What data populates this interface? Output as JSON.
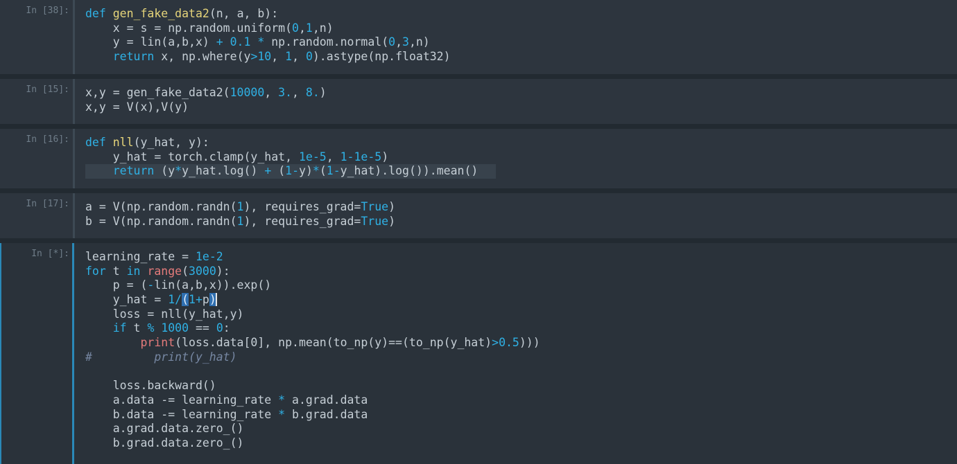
{
  "cells": [
    {
      "prompt": "In [38]:",
      "lines": [
        [
          [
            "kw",
            "def"
          ],
          [
            "t",
            " "
          ],
          [
            "fn",
            "gen_fake_data2"
          ],
          [
            "t",
            "(n, a, b):"
          ]
        ],
        [
          [
            "t",
            "    x = s = np.random.uniform("
          ],
          [
            "num",
            "0"
          ],
          [
            "t",
            ","
          ],
          [
            "num",
            "1"
          ],
          [
            "t",
            ",n)"
          ]
        ],
        [
          [
            "t",
            "    y = lin(a,b,x) "
          ],
          [
            "op",
            "+"
          ],
          [
            "t",
            " "
          ],
          [
            "num",
            "0.1"
          ],
          [
            "t",
            " "
          ],
          [
            "op",
            "*"
          ],
          [
            "t",
            " np.random.normal("
          ],
          [
            "num",
            "0"
          ],
          [
            "t",
            ","
          ],
          [
            "num",
            "3"
          ],
          [
            "t",
            ",n)"
          ]
        ],
        [
          [
            "t",
            "    "
          ],
          [
            "kw",
            "return"
          ],
          [
            "t",
            " x, np.where(y"
          ],
          [
            "op",
            ">"
          ],
          [
            "num",
            "10"
          ],
          [
            "t",
            ", "
          ],
          [
            "num",
            "1"
          ],
          [
            "t",
            ", "
          ],
          [
            "num",
            "0"
          ],
          [
            "t",
            ").astype(np.float32)"
          ]
        ]
      ]
    },
    {
      "prompt": "In [15]:",
      "lines": [
        [
          [
            "t",
            "x,y = gen_fake_data2("
          ],
          [
            "num",
            "10000"
          ],
          [
            "t",
            ", "
          ],
          [
            "num",
            "3."
          ],
          [
            "t",
            ", "
          ],
          [
            "num",
            "8."
          ],
          [
            "t",
            ")"
          ]
        ],
        [
          [
            "t",
            "x,y = V(x),V(y)"
          ]
        ]
      ]
    },
    {
      "prompt": "In [16]:",
      "lines": [
        [
          [
            "kw",
            "def"
          ],
          [
            "t",
            " "
          ],
          [
            "fn",
            "nll"
          ],
          [
            "t",
            "(y_hat, y):"
          ]
        ],
        [
          [
            "t",
            "    y_hat = torch.clamp(y_hat, "
          ],
          [
            "num",
            "1e-5"
          ],
          [
            "t",
            ", "
          ],
          [
            "num",
            "1"
          ],
          [
            "op",
            "-"
          ],
          [
            "num",
            "1e-5"
          ],
          [
            "t",
            ")"
          ]
        ],
        [
          [
            "t",
            "    "
          ],
          [
            "kw",
            "return"
          ],
          [
            "t",
            " (y"
          ],
          [
            "op",
            "*"
          ],
          [
            "t",
            "y_hat.log() "
          ],
          [
            "op",
            "+"
          ],
          [
            "t",
            " ("
          ],
          [
            "num",
            "1"
          ],
          [
            "op",
            "-"
          ],
          [
            "t",
            "y)"
          ],
          [
            "op",
            "*"
          ],
          [
            "t",
            "("
          ],
          [
            "num",
            "1"
          ],
          [
            "op",
            "-"
          ],
          [
            "t",
            "y_hat).log()).mean()"
          ]
        ]
      ]
    },
    {
      "prompt": "In [17]:",
      "lines": [
        [
          [
            "t",
            "a = V(np.random.randn("
          ],
          [
            "num",
            "1"
          ],
          [
            "t",
            "), requires_grad="
          ],
          [
            "const",
            "True"
          ],
          [
            "t",
            ")"
          ]
        ],
        [
          [
            "t",
            "b = V(np.random.randn("
          ],
          [
            "num",
            "1"
          ],
          [
            "t",
            "), requires_grad="
          ],
          [
            "const",
            "True"
          ],
          [
            "t",
            ")"
          ]
        ]
      ]
    },
    {
      "prompt": "In [*]:",
      "lines": [
        [
          [
            "t",
            "learning_rate = "
          ],
          [
            "num",
            "1e-2"
          ]
        ],
        [
          [
            "kw",
            "for"
          ],
          [
            "t",
            " t "
          ],
          [
            "kw",
            "in"
          ],
          [
            "t",
            " "
          ],
          [
            "bi",
            "range"
          ],
          [
            "t",
            "("
          ],
          [
            "num",
            "3000"
          ],
          [
            "t",
            "):"
          ]
        ],
        [
          [
            "t",
            "    p = ("
          ],
          [
            "op",
            "-"
          ],
          [
            "t",
            "lin(a,b,x)).exp()"
          ]
        ],
        [
          [
            "t",
            "    y_hat = "
          ],
          [
            "num",
            "1"
          ],
          [
            "op",
            "/"
          ],
          [
            "hl",
            "("
          ],
          [
            "num",
            "1"
          ],
          [
            "op",
            "+"
          ],
          [
            "t",
            "p"
          ],
          [
            "hl",
            ")"
          ]
        ],
        [
          [
            "t",
            "    loss = nll(y_hat,y)"
          ]
        ],
        [
          [
            "t",
            "    "
          ],
          [
            "kw",
            "if"
          ],
          [
            "t",
            " t "
          ],
          [
            "op",
            "%"
          ],
          [
            "t",
            " "
          ],
          [
            "num",
            "1000"
          ],
          [
            "t",
            " == "
          ],
          [
            "num",
            "0"
          ],
          [
            "t",
            ":"
          ]
        ],
        [
          [
            "t",
            "        "
          ],
          [
            "bi",
            "print"
          ],
          [
            "t",
            "(loss.data[0], np.mean(to_np(y)==(to_np(y_hat)"
          ],
          [
            "op",
            ">"
          ],
          [
            "num",
            "0.5"
          ],
          [
            "t",
            ")))"
          ]
        ],
        [
          [
            "cm",
            "#         print(y_hat)"
          ]
        ],
        [
          [
            "t",
            ""
          ]
        ],
        [
          [
            "t",
            "    loss.backward()"
          ]
        ],
        [
          [
            "t",
            "    a.data -= learning_rate "
          ],
          [
            "op",
            "*"
          ],
          [
            "t",
            " a.grad.data"
          ]
        ],
        [
          [
            "t",
            "    b.data -= learning_rate "
          ],
          [
            "op",
            "*"
          ],
          [
            "t",
            " b.grad.data"
          ]
        ],
        [
          [
            "t",
            "    a.grad.data.zero_()"
          ]
        ],
        [
          [
            "t",
            "    b.grad.data.zero_()"
          ]
        ]
      ]
    }
  ]
}
